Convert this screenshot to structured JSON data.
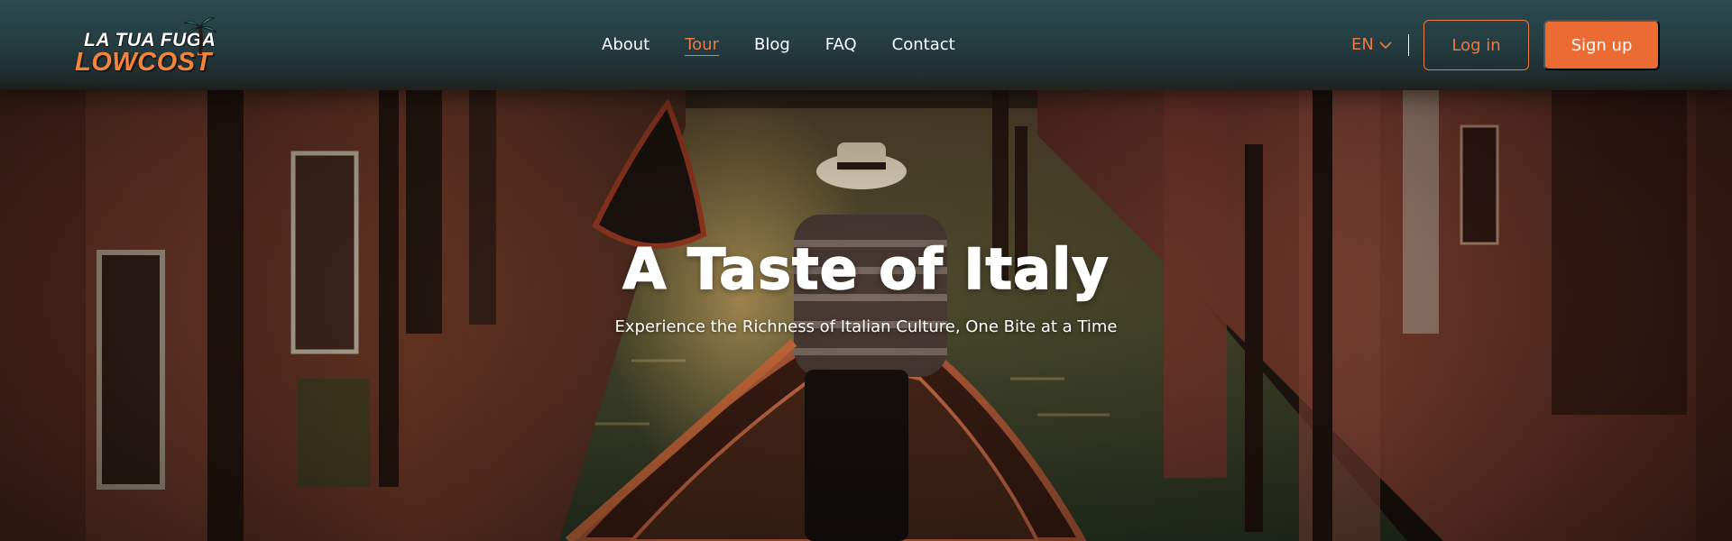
{
  "brand": {
    "logo_line1": "LA TUA FUGA",
    "logo_line2": "LOWCOST",
    "accent_color": "#ec7a45",
    "navbar_color": "#2b4b50"
  },
  "nav": {
    "links": [
      {
        "label": "About",
        "active": false
      },
      {
        "label": "Tour",
        "active": true
      },
      {
        "label": "Blog",
        "active": false
      },
      {
        "label": "FAQ",
        "active": false
      },
      {
        "label": "Contact",
        "active": false
      }
    ]
  },
  "language": {
    "selected": "EN",
    "icon": "chevron-down-icon"
  },
  "auth": {
    "login_label": "Log in",
    "signup_label": "Sign up"
  },
  "hero": {
    "title": "A Taste of Italy",
    "subtitle": "Experience the Richness of Italian Culture, One Bite at a Time"
  }
}
